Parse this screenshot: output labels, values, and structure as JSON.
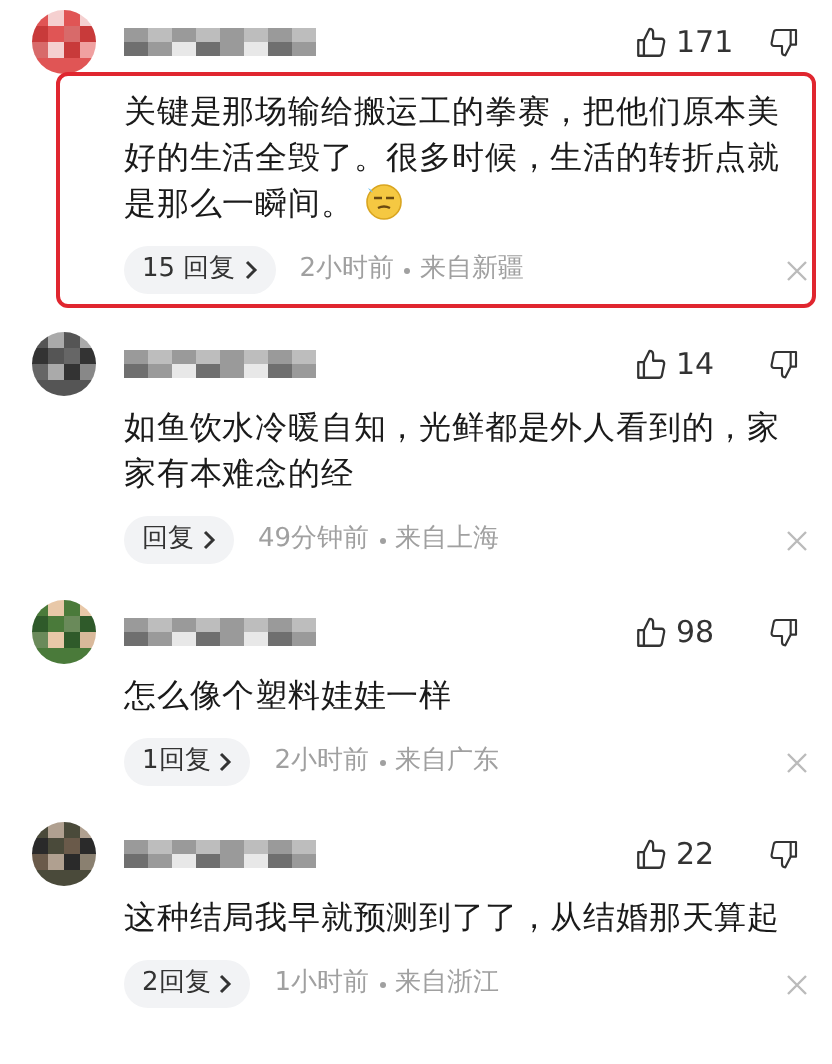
{
  "comments": [
    {
      "likes": "171",
      "highlighted": true,
      "text": "关键是那场输给搬运工的拳赛，把他们原本美好的生活全毁了。很多时候，生活的转折点就是那么一瞬间。",
      "has_emoji": true,
      "replies": "15 回复",
      "time": "2小时前",
      "location": "来自新疆"
    },
    {
      "likes": "14",
      "highlighted": false,
      "text": "如鱼饮水冷暖自知，光鲜都是外人看到的，家家有本难念的经",
      "has_emoji": false,
      "replies": "回复",
      "time": "49分钟前",
      "location": "来自上海"
    },
    {
      "likes": "98",
      "highlighted": false,
      "text": "怎么像个塑料娃娃一样",
      "has_emoji": false,
      "replies": "1回复",
      "time": "2小时前",
      "location": "来自广东"
    },
    {
      "likes": "22",
      "highlighted": false,
      "text": "这种结局我早就预测到了了，从结婚那天算起",
      "has_emoji": false,
      "replies": "2回复",
      "time": "1小时前",
      "location": "来自浙江"
    }
  ]
}
